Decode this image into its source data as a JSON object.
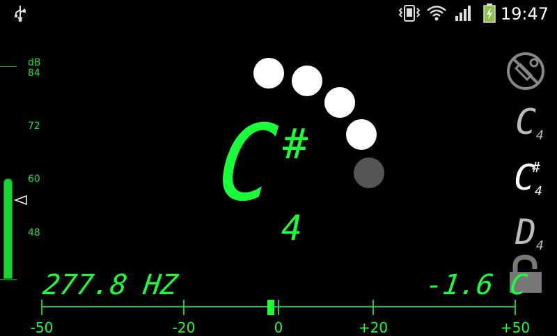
{
  "status_bar": {
    "clock": "19:47",
    "icons": [
      "usb-icon",
      "vibrate-icon",
      "wifi-icon",
      "signal-icon",
      "battery-charging-icon"
    ]
  },
  "db_meter": {
    "unit": "dB",
    "ticks": [
      "84",
      "72",
      "60",
      "48"
    ],
    "level_fraction": 0.45
  },
  "note": {
    "letter": "C",
    "sharp": "#",
    "octave": "4"
  },
  "side_notes": [
    {
      "letter": "C",
      "sharp": "",
      "octave": "4",
      "active": false
    },
    {
      "letter": "C",
      "sharp": "#",
      "octave": "4",
      "active": true
    },
    {
      "letter": "D",
      "sharp": "",
      "octave": "4",
      "active": false
    }
  ],
  "readouts": {
    "frequency": "277.8 HZ",
    "cents": "-1.6 C"
  },
  "scale": {
    "labels": [
      "-50",
      "-20",
      "0",
      "+20",
      "+50"
    ],
    "needle_value": -1.6
  },
  "colors": {
    "accent": "#19ff3a",
    "background": "#000000"
  }
}
